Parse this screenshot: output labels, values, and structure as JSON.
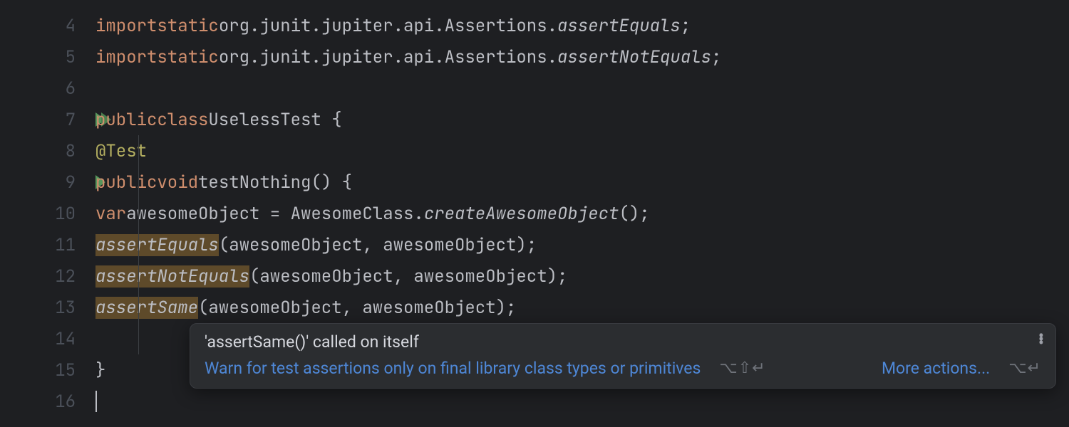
{
  "gutter": {
    "lines": [
      "4",
      "5",
      "6",
      "7",
      "8",
      "9",
      "10",
      "11",
      "12",
      "13",
      "14",
      "15",
      "16"
    ]
  },
  "code": {
    "l4": {
      "kw1": "import",
      "kw2": "static",
      "pkg": "org.junit.jupiter.api.Assertions.",
      "member": "assertEquals",
      "end": ";"
    },
    "l5": {
      "kw1": "import",
      "kw2": "static",
      "pkg": "org.junit.jupiter.api.Assertions.",
      "member": "assertNotEquals",
      "end": ";"
    },
    "l7": {
      "kw1": "public",
      "kw2": "class",
      "name": "UselessTest",
      "brace": " {"
    },
    "l8": {
      "anno": "@Test"
    },
    "l9": {
      "kw1": "public",
      "kw2": "void",
      "name": "testNothing",
      "parens": "() {"
    },
    "l10": {
      "kw": "var",
      "id": "awesomeObject",
      "eq": " = ",
      "cls": "AwesomeClass.",
      "m": "createAwesomeObject",
      "tail": "();"
    },
    "l11": {
      "fn": "assertEquals",
      "args": "(awesomeObject, awesomeObject)",
      "end": ";"
    },
    "l12": {
      "fn": "assertNotEquals",
      "args": "(awesomeObject, awesomeObject)",
      "end": ";"
    },
    "l13": {
      "fn": "assertSame",
      "args": "(awesomeObject, awesomeObject)",
      "end": ";"
    },
    "l15": {
      "brace": "}"
    }
  },
  "popup": {
    "title": "'assertSame()' called on itself",
    "primary_action": "Warn for test assertions only on final library class types or primitives",
    "primary_shortcut": "⌥⇧↵",
    "more_label": "More actions...",
    "more_shortcut": "⌥↵"
  }
}
